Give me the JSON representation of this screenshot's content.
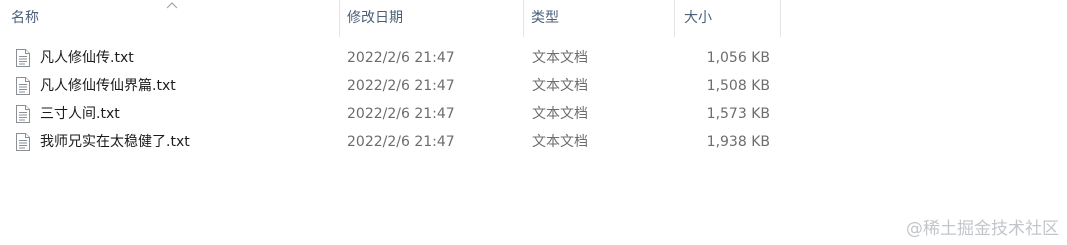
{
  "columns": {
    "name": "名称",
    "date": "修改日期",
    "type": "类型",
    "size": "大小"
  },
  "sort": {
    "column": "name",
    "direction": "ascending",
    "icon": "chevron-up-icon"
  },
  "files": [
    {
      "name": "凡人修仙传.txt",
      "date": "2022/2/6 21:47",
      "type": "文本文档",
      "size": "1,056 KB",
      "icon": "text-file-icon"
    },
    {
      "name": "凡人修仙传仙界篇.txt",
      "date": "2022/2/6 21:47",
      "type": "文本文档",
      "size": "1,508 KB",
      "icon": "text-file-icon"
    },
    {
      "name": "三寸人间.txt",
      "date": "2022/2/6 21:47",
      "type": "文本文档",
      "size": "1,573 KB",
      "icon": "text-file-icon"
    },
    {
      "name": "我师兄实在太稳健了.txt",
      "date": "2022/2/6 21:47",
      "type": "文本文档",
      "size": "1,938 KB",
      "icon": "text-file-icon"
    }
  ],
  "watermark": "@稀土掘金技术社区",
  "colors": {
    "header_text": "#4c607a",
    "secondary_text": "#6d6d6d",
    "primary_text": "#1b1b1b",
    "separator": "#e5e5e5"
  }
}
